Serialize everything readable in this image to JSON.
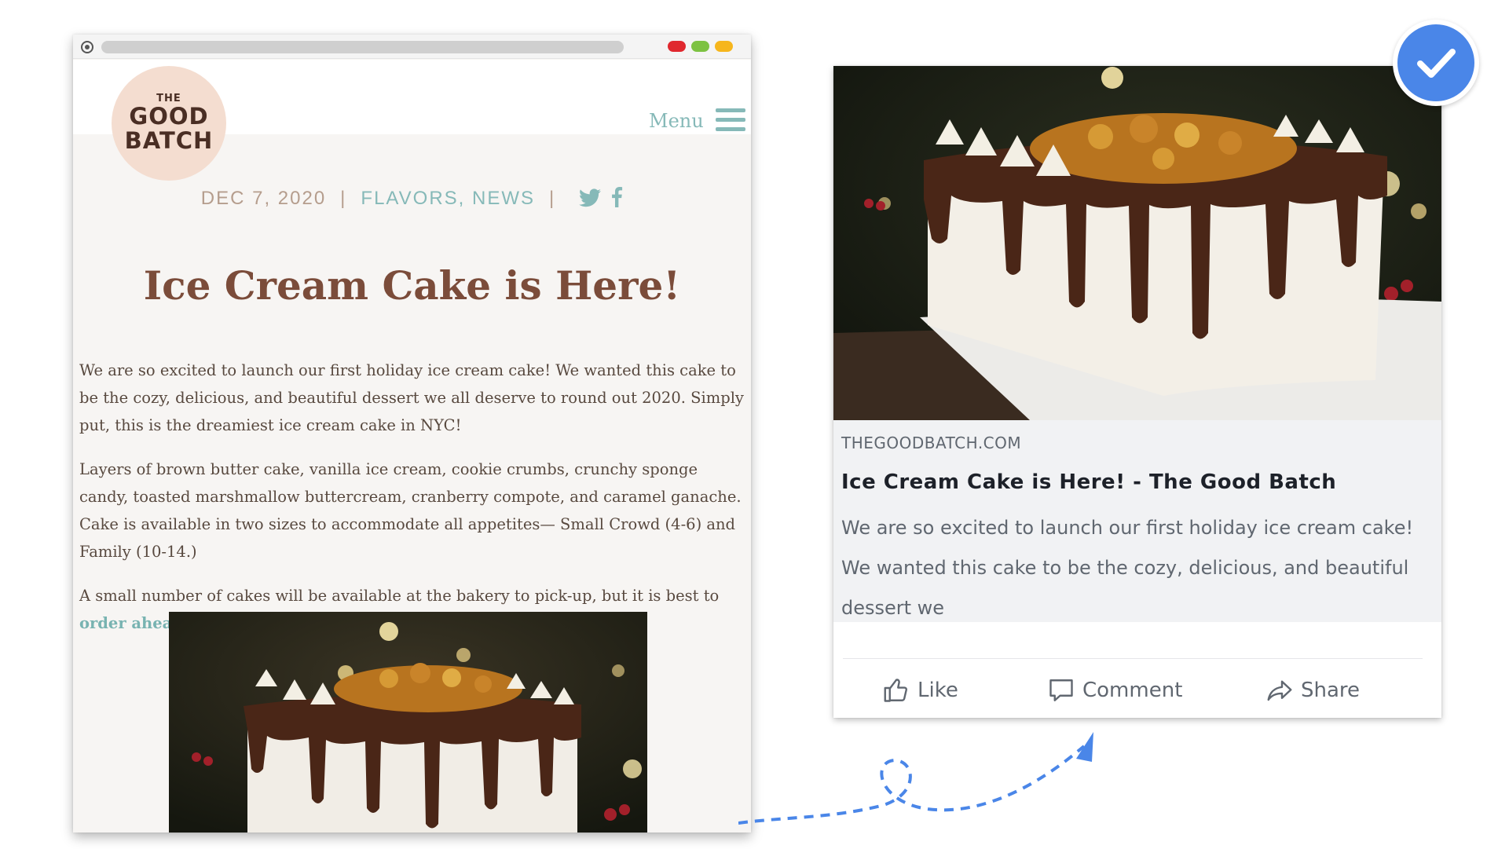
{
  "browser": {
    "menu_label": "Menu",
    "logo": {
      "the": "THE",
      "good": "GOOD",
      "batch": "BATCH"
    }
  },
  "post": {
    "date": "DEC 7, 2020",
    "separator": "|",
    "categories": "FLAVORS, NEWS",
    "title": "Ice Cream Cake is Here!",
    "paragraph1": "We are so excited to launch our first holiday ice cream cake! We wanted this cake to be the cozy, delicious, and beautiful dessert we all deserve to round out 2020. Simply put, this is the dreamiest ice cream cake in NYC!",
    "paragraph2": "Layers of brown butter cake, vanilla ice cream, cookie crumbs, crunchy sponge candy, toasted marshmallow buttercream, cranberry compote, and caramel ganache. Cake is available in two sizes to accommodate all appetites— Small Crowd (4-6) and Family (10-14.)",
    "paragraph3_prefix": "A small number of cakes will be available at the bakery to pick-up, but it is best to ",
    "paragraph3_link": "order ahead of time."
  },
  "share_card": {
    "domain": "THEGOODBATCH.COM",
    "title": "Ice Cream Cake is Here! - The Good Batch",
    "description": "We are so excited to launch our first holiday ice cream cake! We wanted this cake to be the cozy, delicious, and beautiful dessert we",
    "actions": {
      "like": "Like",
      "comment": "Comment",
      "share": "Share"
    }
  },
  "icons": {
    "social": [
      "twitter-icon",
      "facebook-icon"
    ],
    "actions": [
      "thumbs-up-icon",
      "comment-icon",
      "share-icon"
    ],
    "badge": "checkmark-icon"
  },
  "colors": {
    "accent_teal": "#86b9b8",
    "title_brown": "#7b4c3a",
    "badge_blue": "#4a86e8",
    "arrow_blue": "#4a86e8"
  }
}
